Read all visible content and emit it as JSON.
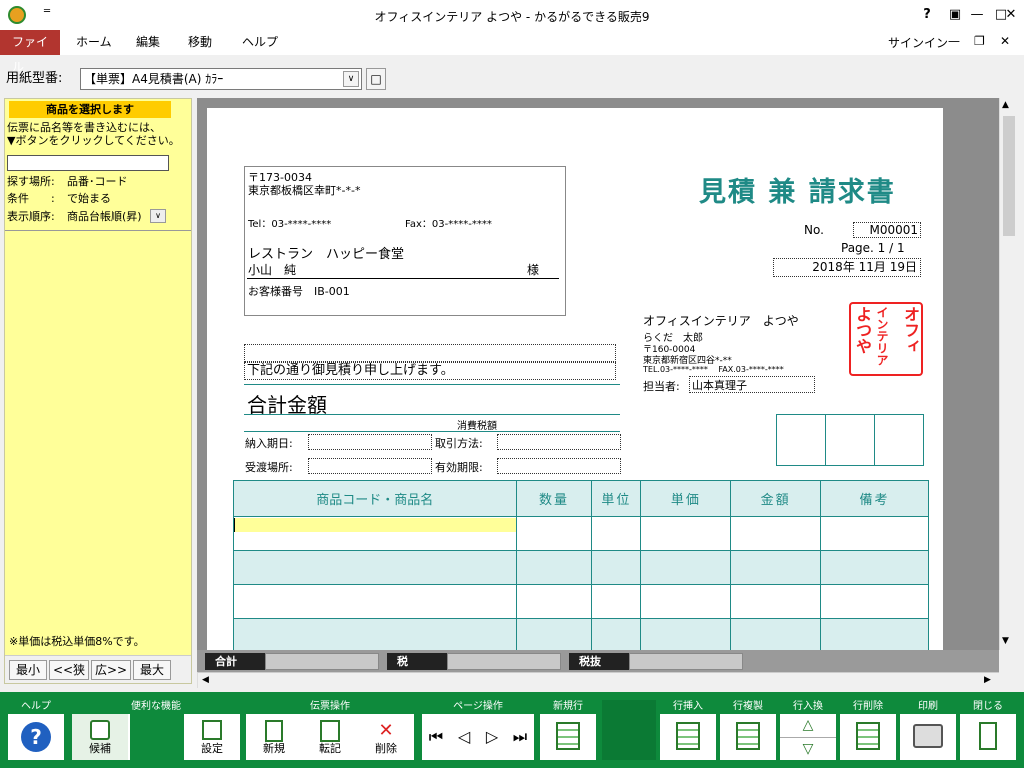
{
  "window": {
    "title": "オフィスインテリア よつや - かるがるできる販売9",
    "help": "?",
    "sign_in": "サインイン"
  },
  "menu": {
    "tabs": [
      "ファイル",
      "ホーム",
      "編集",
      "移動",
      "ヘルプ"
    ]
  },
  "form": {
    "label": "用紙型番:",
    "value": "【単票】A4見積書(A) ｶﾗｰ"
  },
  "left": {
    "header": "商品を選択します",
    "instruction_1": "伝票に品名等を書き込むには、",
    "instruction_2": "▼ボタンをクリックしてください。",
    "search_place_label": "探す場所:",
    "search_place_value": "品番･コード",
    "condition_label": "条件　　:",
    "condition_value": "で始まる",
    "order_label": "表示順序:",
    "order_value": "商品台帳順(昇)",
    "note": "※単価は税込単価8%です。",
    "nav": [
      "最小",
      "<<狭",
      "広>>",
      "最大"
    ]
  },
  "doc": {
    "postal": "〒173-0034",
    "address": "東京都板橋区幸町*-*-*",
    "tel": "Tel：03-****-****",
    "fax": "Fax：03-****-****",
    "customer": "レストラン　ハッピー食堂",
    "person": "小山　純",
    "honorific": "様",
    "cust_no": "お客様番号　IB-001",
    "title": "見積 兼 請求書",
    "no_label": "No.",
    "no_value": "M00001",
    "page": "Page. 1 / 1",
    "date": "2018年 11月 19日",
    "company": "オフィスインテリア　よつや",
    "rep": "らくだ　太郎",
    "co_postal": "〒160-0004",
    "co_address": "東京都新宿区四谷*-**",
    "co_tel": "TEL.03-****-****　 FAX.03-****-****",
    "staff_label": "担当者:",
    "staff_value": "山本真理子",
    "seal": [
      "オフィ",
      "インテリア",
      "よつや"
    ],
    "greeting": "下記の通り御見積り申し上げます。",
    "total_label": "合計金額",
    "tax_label": "消費税額",
    "delivery_label": "納入期日:",
    "trade_label": "取引方法:",
    "place_label": "受渡場所:",
    "valid_label": "有効期限:",
    "columns": [
      "商品コード・商品名",
      "数量",
      "単位",
      "単価",
      "金額",
      "備考"
    ]
  },
  "totals": [
    "合計",
    "税",
    "税抜"
  ],
  "toolbar": {
    "groups": [
      {
        "label": "ヘルプ",
        "buttons": [
          ""
        ]
      },
      {
        "label": "便利な機能",
        "buttons": [
          "候補",
          "設定"
        ]
      },
      {
        "label": "伝票操作",
        "buttons": [
          "新規",
          "転記",
          "削除"
        ]
      },
      {
        "label": "ページ操作",
        "buttons": []
      },
      {
        "label": "新規行",
        "buttons": [
          ""
        ]
      },
      {
        "label": "行挿入",
        "buttons": [
          ""
        ]
      },
      {
        "label": "行複製",
        "buttons": [
          ""
        ]
      },
      {
        "label": "行入換",
        "buttons": [
          ""
        ]
      },
      {
        "label": "行削除",
        "buttons": [
          ""
        ]
      },
      {
        "label": "印刷",
        "buttons": [
          ""
        ]
      },
      {
        "label": "閉じる",
        "buttons": [
          ""
        ]
      }
    ]
  }
}
